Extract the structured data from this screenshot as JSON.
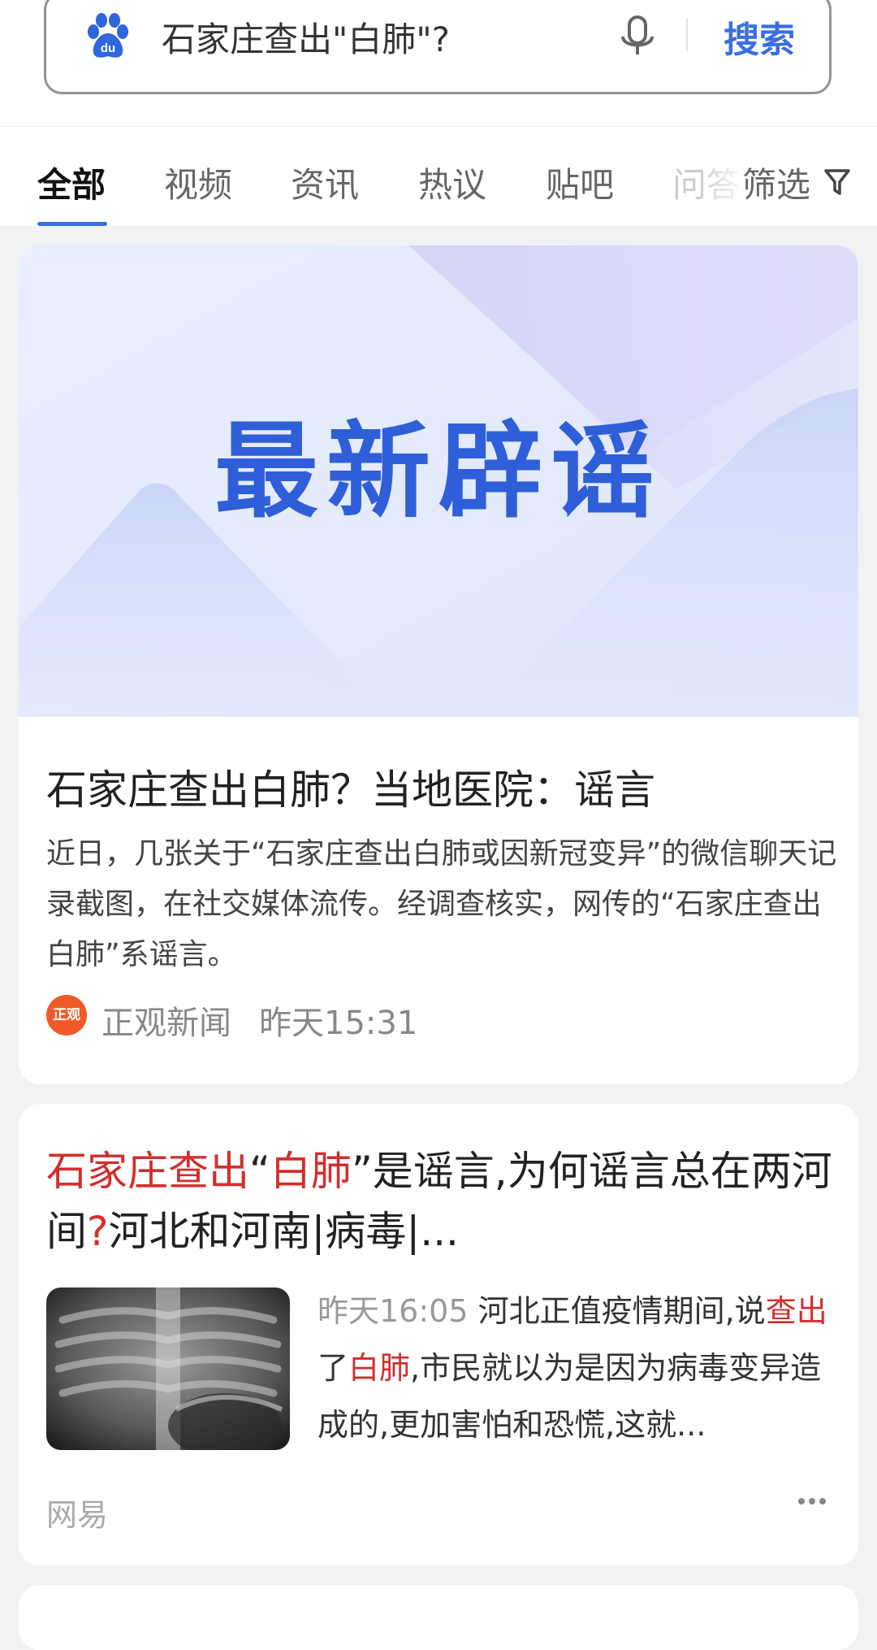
{
  "search": {
    "query": "石家庄查出\"白肺\"?",
    "button_label": "搜索"
  },
  "tabs": [
    {
      "label": "全部",
      "active": true
    },
    {
      "label": "视频"
    },
    {
      "label": "资讯"
    },
    {
      "label": "热议"
    },
    {
      "label": "贴吧"
    },
    {
      "label": "问答"
    }
  ],
  "filter": {
    "label": "筛选"
  },
  "card1": {
    "banner_text": "最新辟谣",
    "title": "石家庄查出白肺？当地医院：谣言",
    "body": "近日，几张关于“石家庄查出白肺或因新冠变异”的微信聊天记录截图，在社交媒体流传。经调查核实，网传的“石家庄查出白肺”系谣言。",
    "source_logo_text": "正观",
    "source_name": "正观新闻",
    "time": "昨天15:31"
  },
  "card2": {
    "title_parts": [
      "石家庄查出",
      "“",
      "白肺",
      "”是谣言,为何谣言总在两河间",
      "?",
      "河北和河南|病毒|..."
    ],
    "time": "昨天16:05",
    "snippet_parts": [
      " 河北正值疫情期间,说",
      "查出",
      "了",
      "白肺",
      ",市民就以为是因为病毒变异造成的,更加害怕和恐慌,这就..."
    ],
    "source": "网易"
  },
  "colors": {
    "accent": "#3a6fe0",
    "highlight": "#d42d2d",
    "banner_text": "#2f5fd8"
  }
}
